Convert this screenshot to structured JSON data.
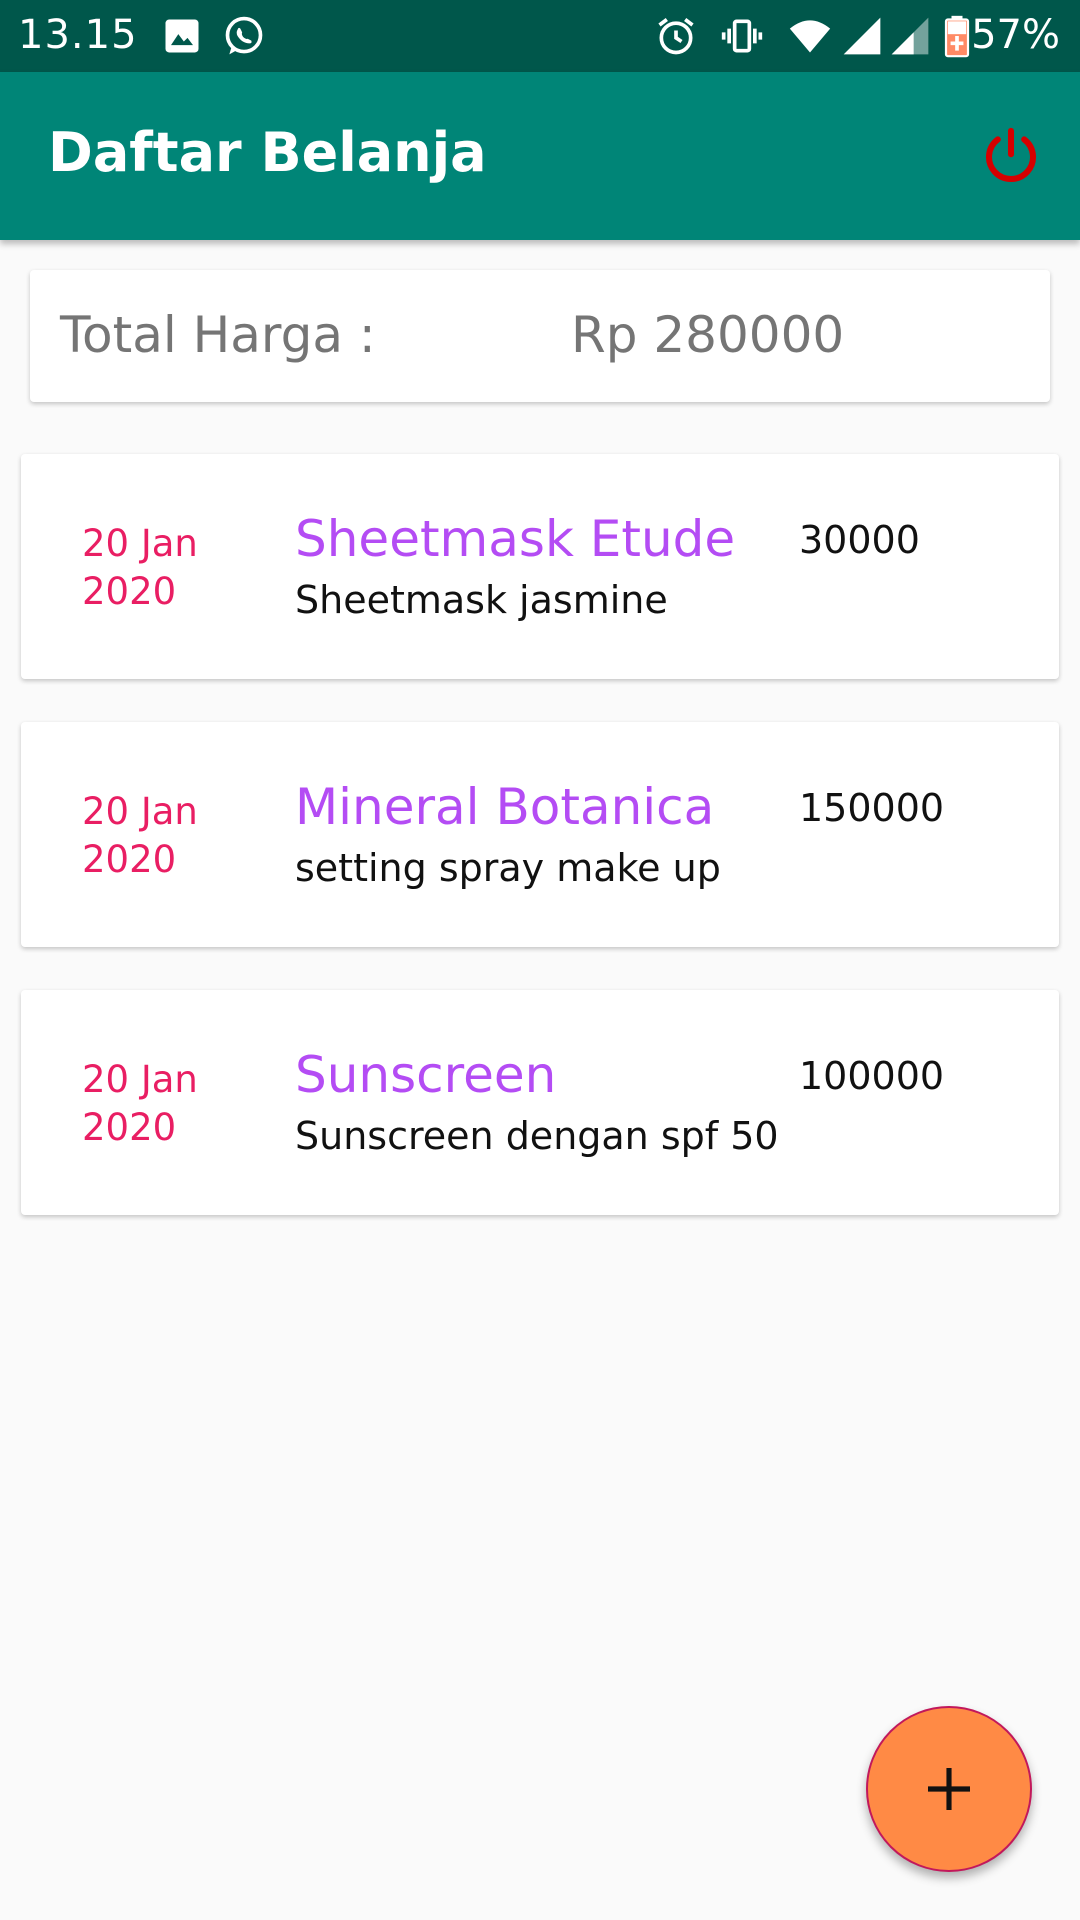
{
  "status_bar": {
    "time": "13.15",
    "battery": "57%",
    "icons": [
      "image-icon",
      "whatsapp-icon",
      "alarm-icon",
      "vibrate-icon",
      "wifi-icon",
      "signal-icon",
      "signal-icon",
      "battery-charging-icon"
    ]
  },
  "app_bar": {
    "title": "Daftar Belanja",
    "power_icon": "power-icon",
    "power_color": "#d50000"
  },
  "summary": {
    "label": "Total Harga :",
    "value": "Rp 280000"
  },
  "items": [
    {
      "date": "20 Jan 2020",
      "name": "Sheetmask Etude",
      "description": "Sheetmask jasmine",
      "price": "30000"
    },
    {
      "date": "20 Jan 2020",
      "name": "Mineral Botanica",
      "description": "setting spray make up",
      "price": "150000"
    },
    {
      "date": "20 Jan 2020",
      "name": "Sunscreen",
      "description": "Sunscreen dengan spf 50",
      "price": "100000"
    }
  ],
  "fab": {
    "icon": "plus-icon",
    "color": "#ff8a45"
  },
  "colors": {
    "status_bar": "#00574b",
    "app_bar": "#008577",
    "date": "#e91e63",
    "item_name": "#b44cf4"
  }
}
